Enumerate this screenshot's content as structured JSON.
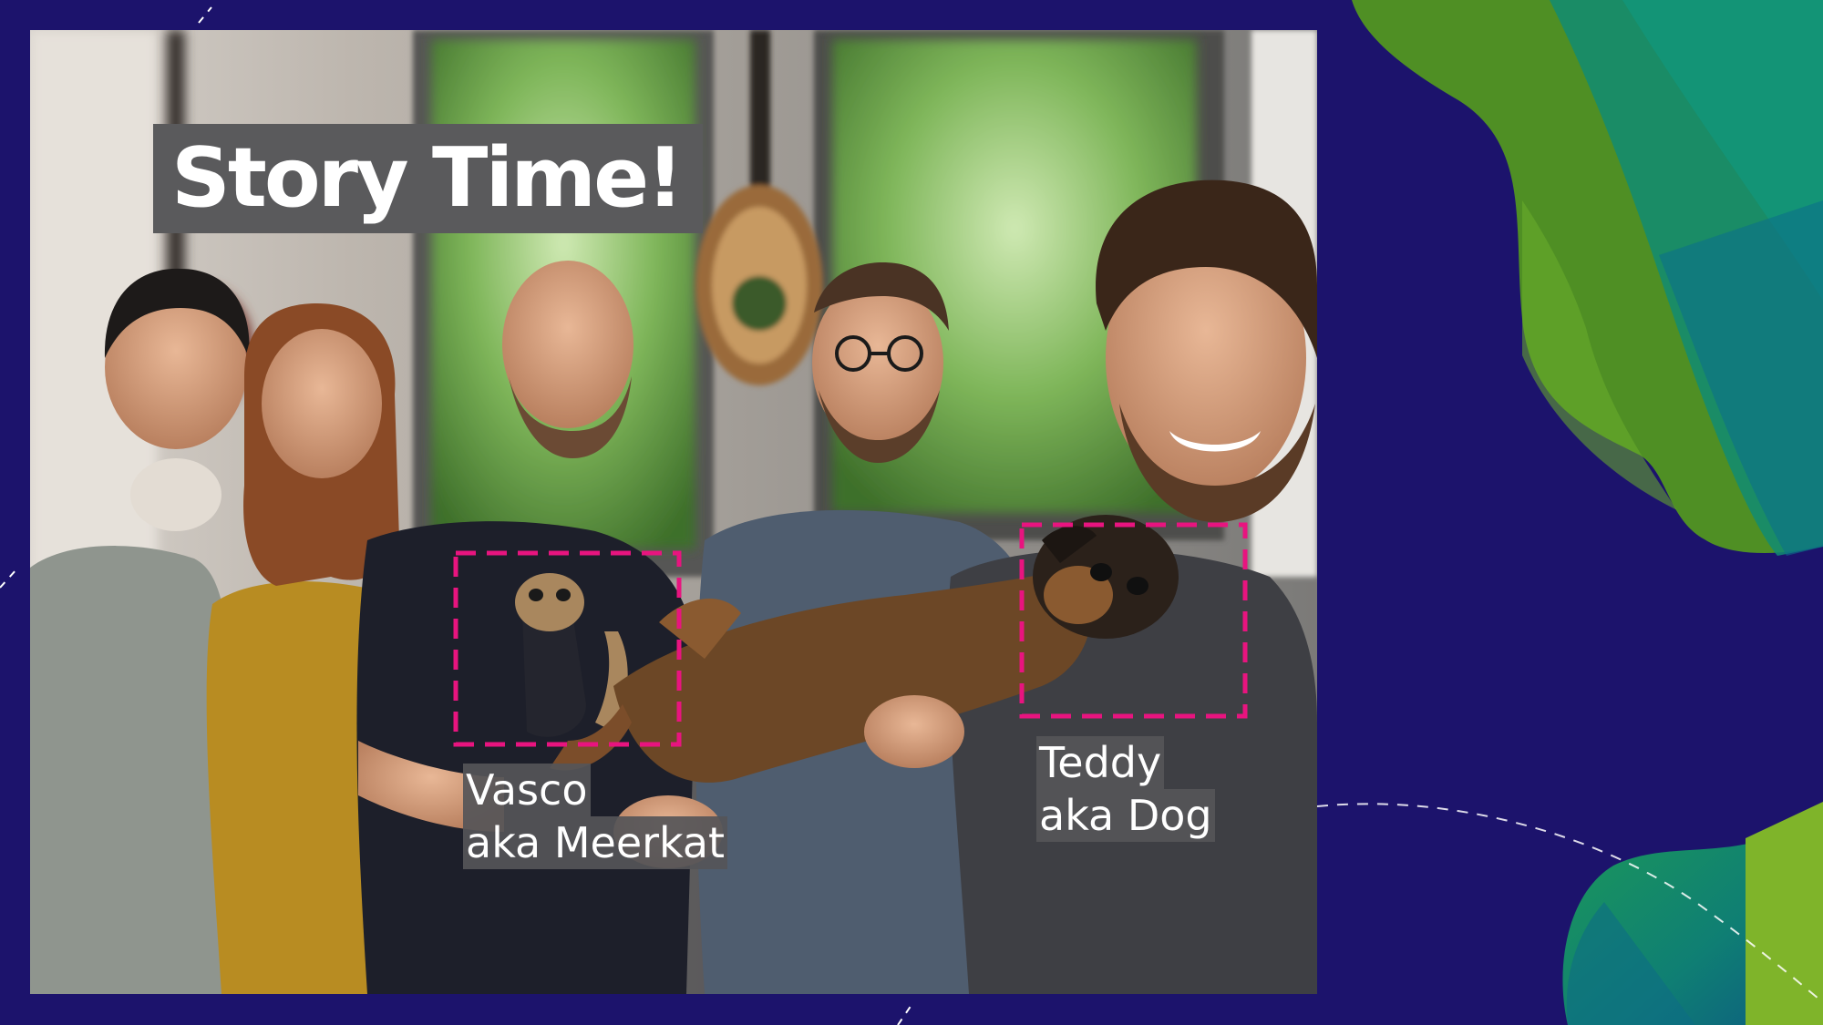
{
  "slide": {
    "title": "Story Time!",
    "annotations": [
      {
        "line1": "Vasco",
        "line2": "aka Meerkat"
      },
      {
        "line1": "Teddy",
        "line2": "aka Dog"
      }
    ],
    "colors": {
      "background": "#1c136c",
      "highlight_box": "#e8147f",
      "label_background": "#55555a",
      "accent_green": "#5fa83a",
      "accent_teal": "#0f8a6c"
    }
  }
}
